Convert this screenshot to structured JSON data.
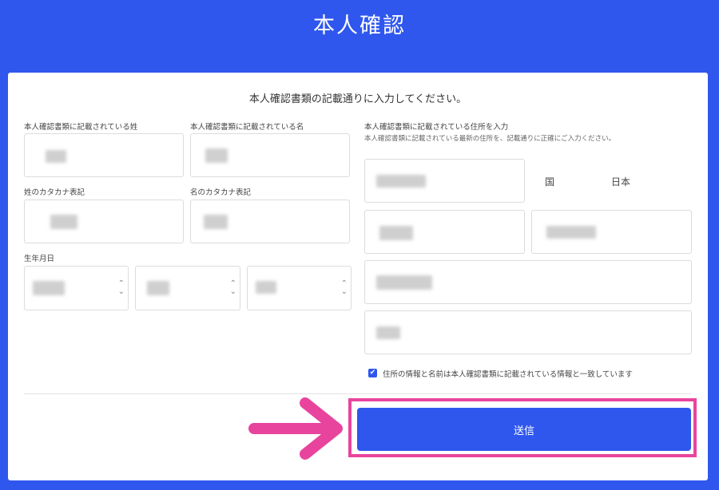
{
  "header": {
    "title": "本人確認"
  },
  "form": {
    "instruction": "本人確認書類の記載通りに入力してください。",
    "labels": {
      "last_name": "本人確認書類に記載されている姓",
      "first_name": "本人確認書類に記載されている名",
      "last_name_kana": "姓のカタカナ表記",
      "first_name_kana": "名のカタカナ表記",
      "birthdate": "生年月日",
      "address": "本人確認書類に記載されている住所を入力",
      "address_note": "本人確認書類に記載されている最新の住所を、記載通りに正確にご入力ください。"
    },
    "country": {
      "label": "国",
      "value": "日本"
    },
    "confirm_checkbox": {
      "checked": true,
      "label": "住所の情報と名前は本人確認書類に記載されている情報と一致しています"
    },
    "submit_label": "送信"
  },
  "annotation": {
    "arrow_color": "#e8449d"
  },
  "colors": {
    "brand": "#2f57ee",
    "highlight": "#e8449d"
  }
}
